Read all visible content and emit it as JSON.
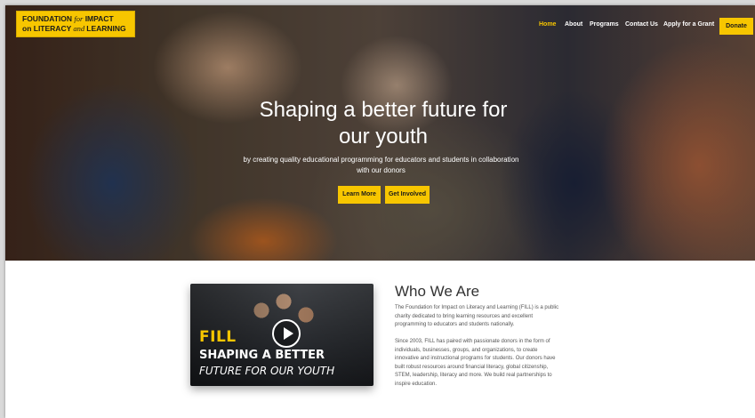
{
  "logo": {
    "line1_a": "FOUNDATION ",
    "line1_b": "for",
    "line1_c": " IMPACT",
    "line2_a": "on ",
    "line2_b": "LITERACY",
    "line2_c": " and ",
    "line2_d": "LEARNING"
  },
  "nav": {
    "home": "Home",
    "about": "About",
    "programs": "Programs",
    "contact": "Contact Us",
    "apply": "Apply for a Grant",
    "donate": "Donate"
  },
  "hero": {
    "title_line1": "Shaping a better future for",
    "title_line2": "our youth",
    "sub_line1": "by creating quality educational programming for educators and students in collaboration",
    "sub_line2": "with our donors",
    "learn_more": "Learn More",
    "get_involved": "Get Involved"
  },
  "video": {
    "brand": "FILL",
    "line1": "SHAPING A BETTER",
    "line2": "FUTURE FOR OUR YOUTH"
  },
  "who": {
    "title": "Who We Are",
    "p1_l1": "The Foundation for Impact on Literacy and Learning (FILL) is a public",
    "p1_l2": "charity dedicated to bring learning resources and excellent",
    "p1_l3": "programming to educators and students nationally.",
    "p2_l1": "Since 2003, FILL has paired with passionate donors in the form of",
    "p2_l2": "individuals, businesses, groups, and organizations, to create",
    "p2_l3": "innovative and instructional programs for students. Our donors have",
    "p2_l4": "built robust resources around financial literacy, global citizenship,",
    "p2_l5": "STEM, leadership, literacy and more. We build real partnerships to",
    "p2_l6": "inspire education."
  },
  "colors": {
    "accent": "#f7c600",
    "text_dark": "#333333",
    "text_body": "#555555"
  }
}
